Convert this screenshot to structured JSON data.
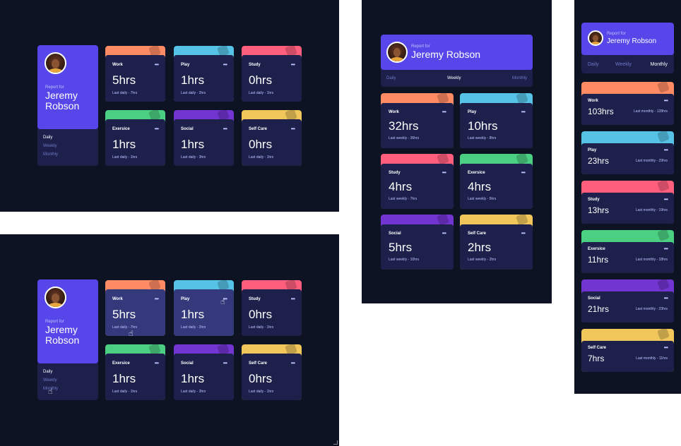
{
  "user": {
    "report_label": "Report for",
    "name_first": "Jeremy",
    "name_last": "Robson",
    "name_full": "Jeremy Robson"
  },
  "periods": [
    "Daily",
    "Weekly",
    "Monthly"
  ],
  "card_colors": {
    "Work": "#ff8b64",
    "Play": "#55c2e6",
    "Study": "#ff5e7d",
    "Exersice": "#4bcf82",
    "Social": "#7335d2",
    "Self Care": "#f1c75b"
  },
  "menu_dots": "•••",
  "views": {
    "desktop_daily": {
      "active_period": "Daily",
      "cards": [
        {
          "title": "Work",
          "hours": "5hrs",
          "previous": "Last daily - 7hrs"
        },
        {
          "title": "Play",
          "hours": "1hrs",
          "previous": "Last daily - 2hrs"
        },
        {
          "title": "Study",
          "hours": "0hrs",
          "previous": "Last daily - 1hrs"
        },
        {
          "title": "Exersice",
          "hours": "1hrs",
          "previous": "Last daily - 1hrs"
        },
        {
          "title": "Social",
          "hours": "1hrs",
          "previous": "Last daily - 3hrs"
        },
        {
          "title": "Self Care",
          "hours": "0hrs",
          "previous": "Last daily - 1hrs"
        }
      ]
    },
    "desktop_hover": {
      "active_period": "Daily",
      "cards": [
        {
          "title": "Work",
          "hours": "5hrs",
          "previous": "Last daily - 7hrs"
        },
        {
          "title": "Play",
          "hours": "1hrs",
          "previous": "Last daily - 2hrs"
        },
        {
          "title": "Study",
          "hours": "0hrs",
          "previous": "Last daily - 1hrs"
        },
        {
          "title": "Exersice",
          "hours": "1hrs",
          "previous": "Last daily - 1hrs"
        },
        {
          "title": "Social",
          "hours": "1hrs",
          "previous": "Last daily - 3hrs"
        },
        {
          "title": "Self Care",
          "hours": "0hrs",
          "previous": "Last daily - 1hrs"
        }
      ]
    },
    "tablet_weekly": {
      "active_period": "Weekly",
      "cards": [
        {
          "title": "Work",
          "hours": "32hrs",
          "previous": "Last weekly - 36hrs"
        },
        {
          "title": "Play",
          "hours": "10hrs",
          "previous": "Last weekly - 8hrs"
        },
        {
          "title": "Study",
          "hours": "4hrs",
          "previous": "Last weekly - 7hrs"
        },
        {
          "title": "Exersice",
          "hours": "4hrs",
          "previous": "Last weekly - 5hrs"
        },
        {
          "title": "Social",
          "hours": "5hrs",
          "previous": "Last weekly - 10hrs"
        },
        {
          "title": "Self Care",
          "hours": "2hrs",
          "previous": "Last weekly - 2hrs"
        }
      ]
    },
    "mobile_monthly": {
      "active_period": "Monthly",
      "cards": [
        {
          "title": "Work",
          "hours": "103hrs",
          "previous": "Last monthly - 128hrs"
        },
        {
          "title": "Play",
          "hours": "23hrs",
          "previous": "Last monthly - 29hrs"
        },
        {
          "title": "Study",
          "hours": "13hrs",
          "previous": "Last monthly - 19hrs"
        },
        {
          "title": "Exersice",
          "hours": "11hrs",
          "previous": "Last monthly - 18hrs"
        },
        {
          "title": "Social",
          "hours": "21hrs",
          "previous": "Last monthly - 23hrs"
        },
        {
          "title": "Self Care",
          "hours": "7hrs",
          "previous": "Last monthly - 11hrs"
        }
      ]
    }
  }
}
